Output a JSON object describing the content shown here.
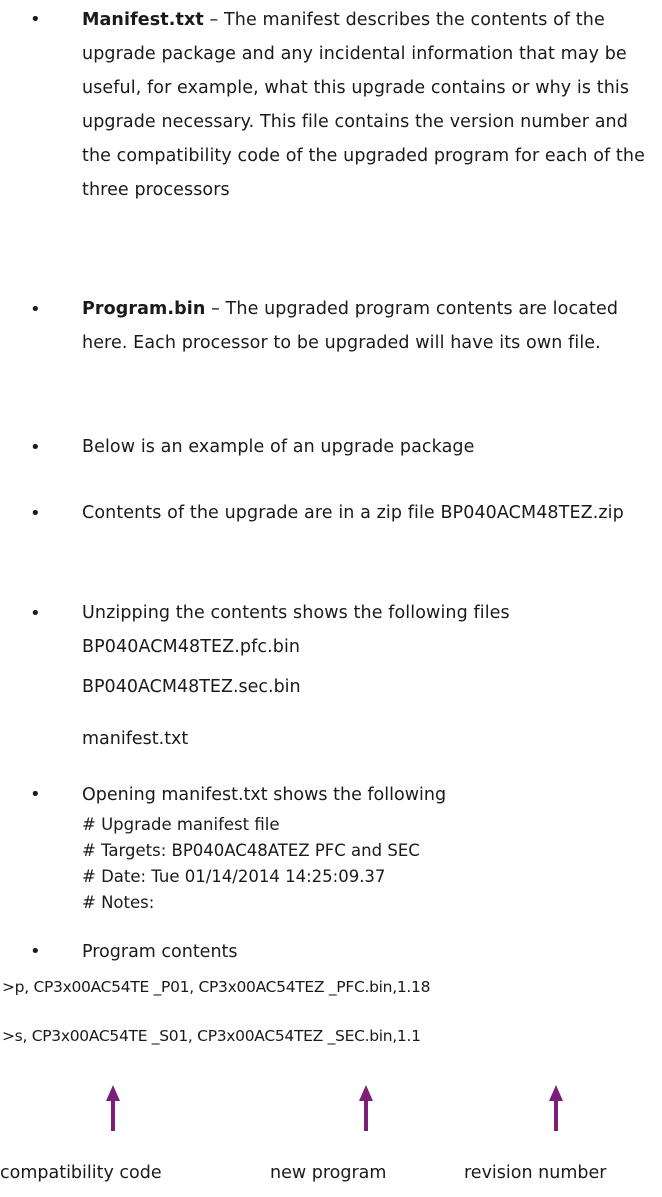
{
  "bullets": [
    {
      "bold": "Manifest.txt",
      "text": " – The manifest describes the contents of the upgrade package and any incidental information that may be useful, for example, what this upgrade contains or why is this upgrade necessary.  This file contains  the version number and the compatibility code of the upgraded program for each of the three processors"
    },
    {
      "bold": "Program.bin",
      "text": " – The upgraded program contents are located here. Each processor to be upgraded will have its own file."
    },
    {
      "text": "Below is an example of an upgrade package"
    },
    {
      "text": "Contents of the upgrade are in a zip file BP040ACM48TEZ.zip"
    },
    {
      "text": "Unzipping the contents shows the following files BP040ACM48TEZ.pfc.bin"
    }
  ],
  "unzipped_files_extra": [
    "BP040ACM48TEZ.sec.bin",
    "manifest.txt"
  ],
  "manifest_intro": "Opening manifest.txt shows the following",
  "manifest_lines": [
    "# Upgrade manifest file",
    "# Targets: BP040AC48ATEZ PFC and SEC",
    "# Date: Tue 01/14/2014 14:25:09.37",
    "# Notes:"
  ],
  "program_contents_label": "Program contents",
  "program_lines": [
    ">p,  CP3x00AC54TE _P01, CP3x00AC54TEZ _PFC.bin,1.18",
    ">s, CP3x00AC54TE _S01, CP3x00AC54TEZ _SEC.bin,1.1"
  ],
  "captions": [
    "compatibility code",
    "new program",
    "revision number"
  ],
  "colors": {
    "arrow": "#7b1f78",
    "text": "#1a1a1a"
  }
}
